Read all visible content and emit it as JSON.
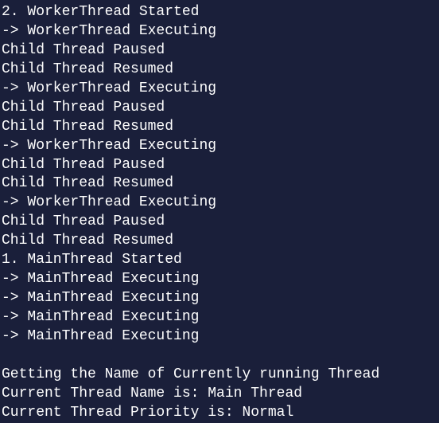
{
  "console": {
    "lines": [
      "2. WorkerThread Started",
      "-> WorkerThread Executing",
      "Child Thread Paused",
      "Child Thread Resumed",
      "-> WorkerThread Executing",
      "Child Thread Paused",
      "Child Thread Resumed",
      "-> WorkerThread Executing",
      "Child Thread Paused",
      "Child Thread Resumed",
      "-> WorkerThread Executing",
      "Child Thread Paused",
      "Child Thread Resumed",
      "1. MainThread Started",
      "-> MainThread Executing",
      "-> MainThread Executing",
      "-> MainThread Executing",
      "-> MainThread Executing",
      "",
      "Getting the Name of Currently running Thread",
      "Current Thread Name is: Main Thread",
      "Current Thread Priority is: Normal"
    ]
  }
}
